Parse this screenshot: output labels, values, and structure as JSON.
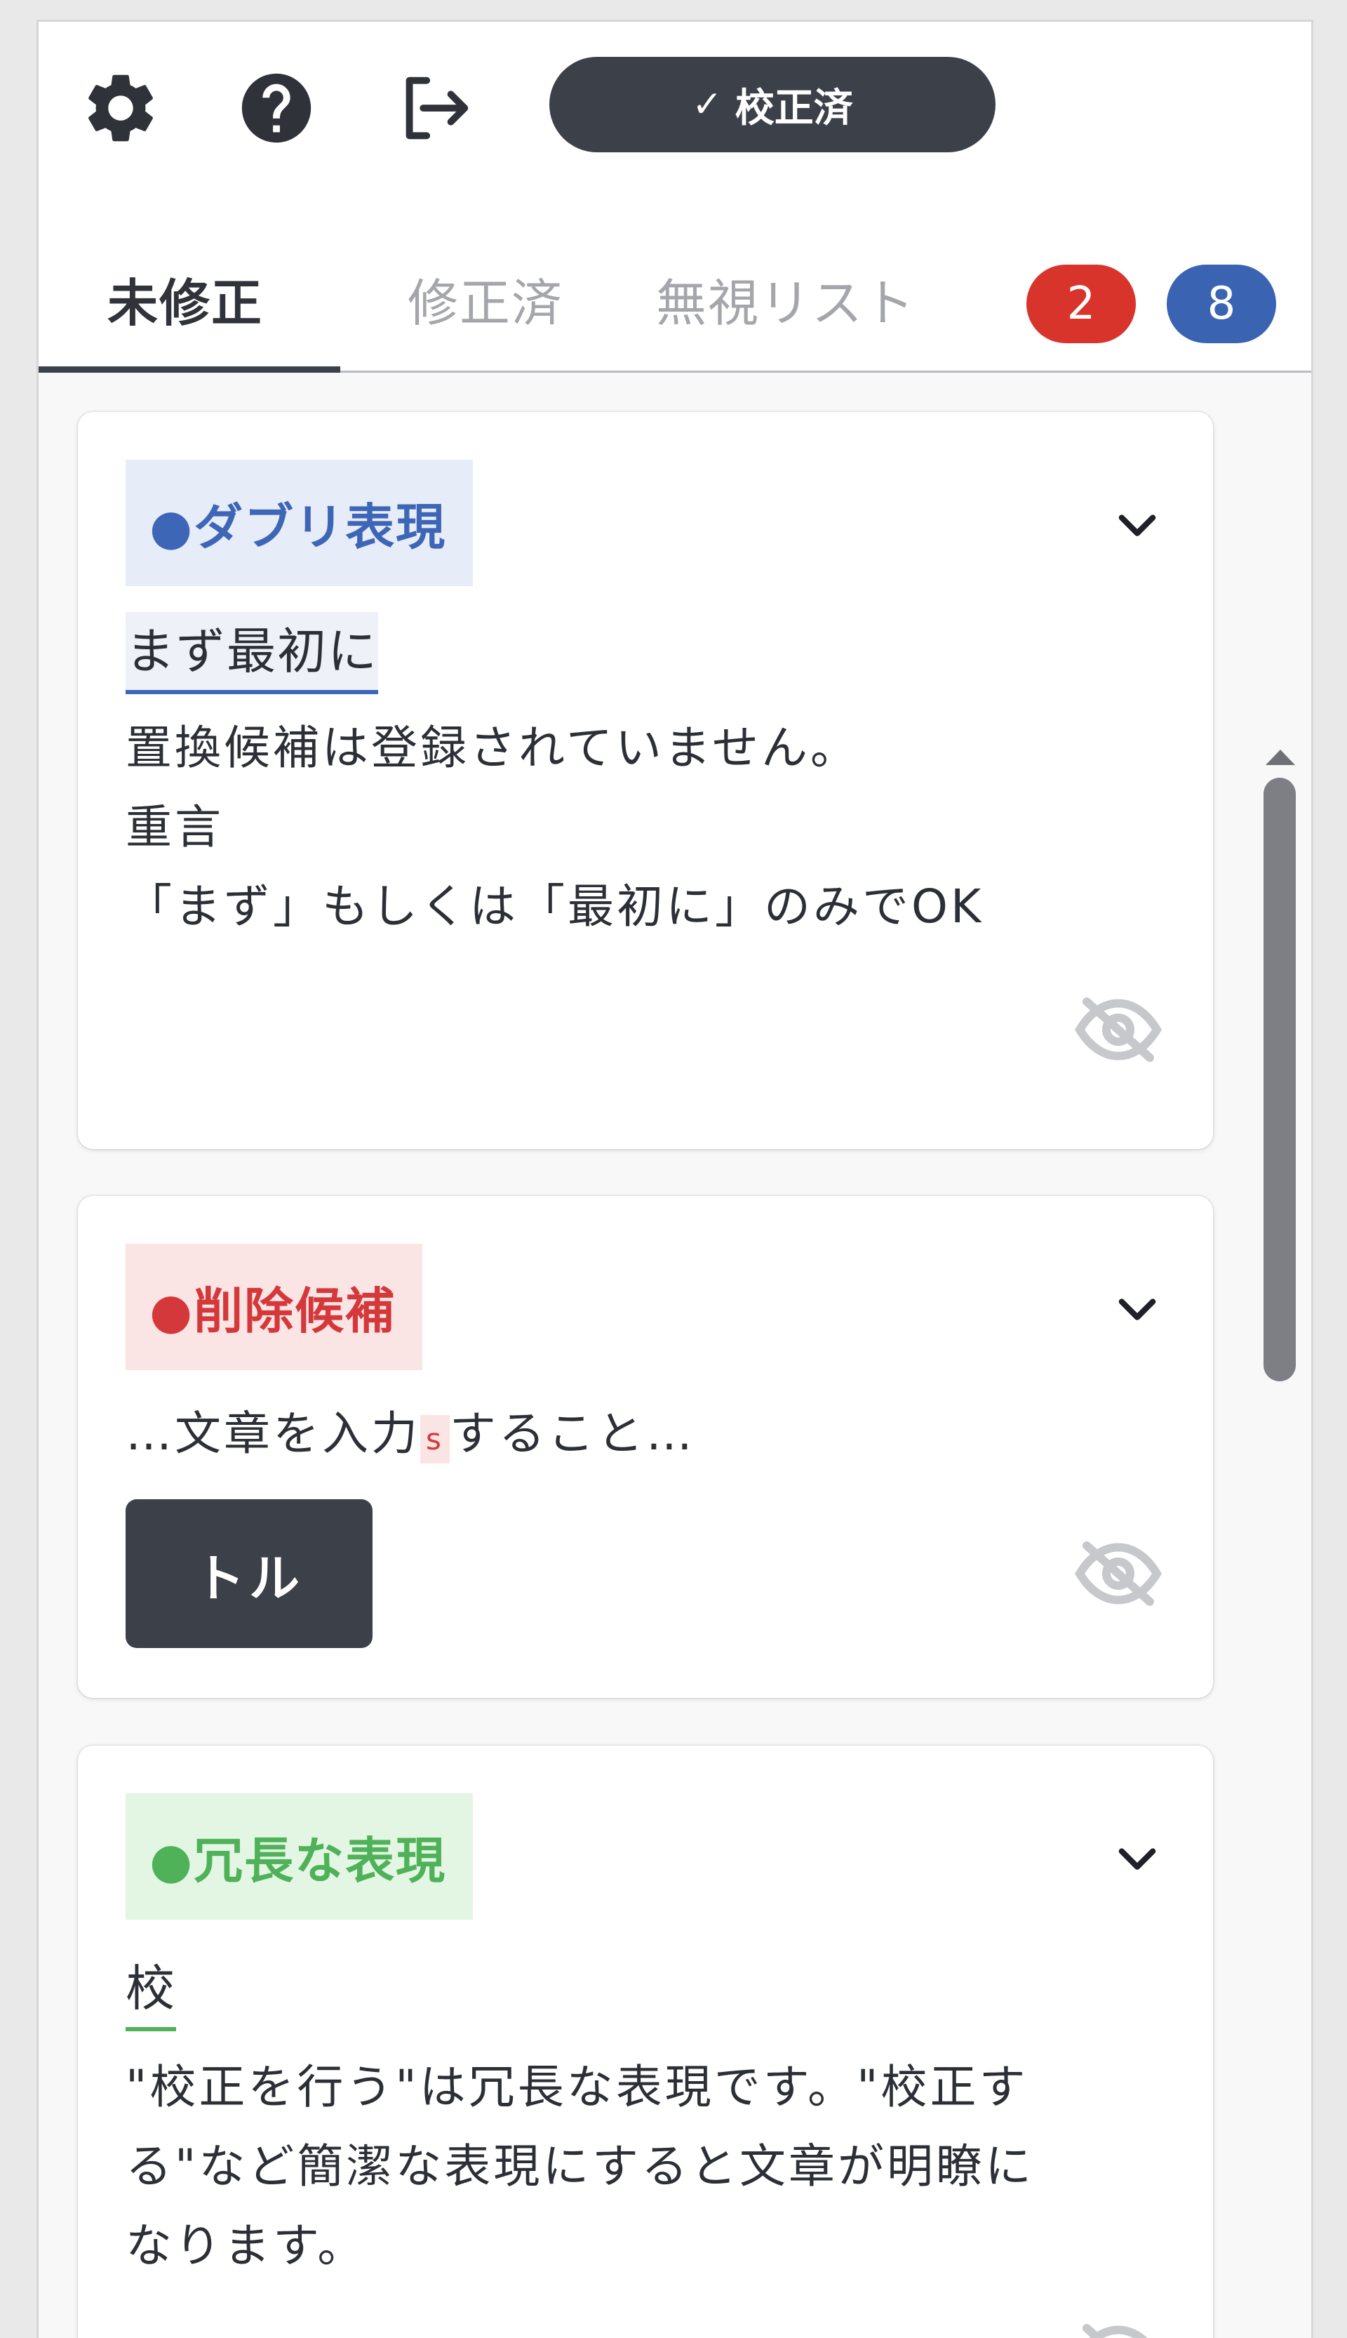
{
  "toolbar": {
    "settings_icon": "gear-icon",
    "help_icon": "question-circle-icon",
    "logout_icon": "logout-icon",
    "status_check": "✓",
    "status_label": "校正済"
  },
  "tabs": [
    {
      "label": "未修正",
      "active": true
    },
    {
      "label": "修正済",
      "active": false
    },
    {
      "label": "無視リスト",
      "active": false
    }
  ],
  "badges": [
    {
      "count": "2",
      "color": "#d9342b"
    },
    {
      "count": "8",
      "color": "#3a64b2"
    }
  ],
  "cards": [
    {
      "tag": "●ダブリ表現",
      "tag_color": "#3e66b6",
      "phrase": "まず最初に",
      "lines": [
        "置換候補は登録されていません。",
        "重言",
        "「まず」もしくは「最初に」のみでOK"
      ]
    },
    {
      "tag": "●削除候補",
      "tag_color": "#d4383a",
      "snippet_before": "…文章を入力",
      "snippet_mark": "s",
      "snippet_after": "すること…",
      "button": "トル"
    },
    {
      "tag": "●冗長な表現",
      "tag_color": "#4fb158",
      "phrase": "校",
      "lines": [
        "\"校正を行う\"は冗長な表現です。\"校正す",
        "る\"など簡潔な表現にすると文章が明瞭に",
        "なります。"
      ]
    }
  ]
}
